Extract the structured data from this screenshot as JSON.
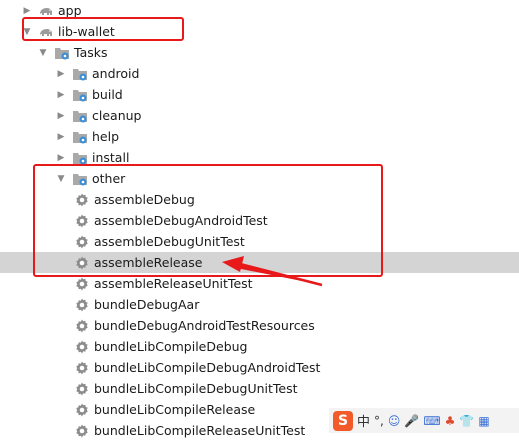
{
  "tree": {
    "nodes": [
      {
        "label": "app",
        "icon": "gradle-elephant-icon",
        "arrow": "right"
      },
      {
        "label": "lib-wallet",
        "icon": "gradle-elephant-icon",
        "arrow": "down"
      },
      {
        "label": "Tasks",
        "icon": "folder-gear-icon",
        "arrow": "down"
      },
      {
        "label": "android",
        "icon": "folder-gear-icon",
        "arrow": "right"
      },
      {
        "label": "build",
        "icon": "folder-gear-icon",
        "arrow": "right"
      },
      {
        "label": "cleanup",
        "icon": "folder-gear-icon",
        "arrow": "right"
      },
      {
        "label": "help",
        "icon": "folder-gear-icon",
        "arrow": "right"
      },
      {
        "label": "install",
        "icon": "folder-gear-icon",
        "arrow": "right"
      },
      {
        "label": "other",
        "icon": "folder-gear-icon",
        "arrow": "down"
      },
      {
        "label": "assembleDebug",
        "icon": "gear-icon"
      },
      {
        "label": "assembleDebugAndroidTest",
        "icon": "gear-icon"
      },
      {
        "label": "assembleDebugUnitTest",
        "icon": "gear-icon"
      },
      {
        "label": "assembleRelease",
        "icon": "gear-icon",
        "selected": true
      },
      {
        "label": "assembleReleaseUnitTest",
        "icon": "gear-icon"
      },
      {
        "label": "bundleDebugAar",
        "icon": "gear-icon"
      },
      {
        "label": "bundleDebugAndroidTestResources",
        "icon": "gear-icon"
      },
      {
        "label": "bundleLibCompileDebug",
        "icon": "gear-icon"
      },
      {
        "label": "bundleLibCompileDebugAndroidTest",
        "icon": "gear-icon"
      },
      {
        "label": "bundleLibCompileDebugUnitTest",
        "icon": "gear-icon"
      },
      {
        "label": "bundleLibCompileRelease",
        "icon": "gear-icon"
      },
      {
        "label": "bundleLibCompileReleaseUnitTest",
        "icon": "gear-icon"
      }
    ]
  },
  "ime": {
    "mode": "中"
  },
  "colors": {
    "annotation": "#e8191a",
    "selection": "#d4d4d4"
  }
}
